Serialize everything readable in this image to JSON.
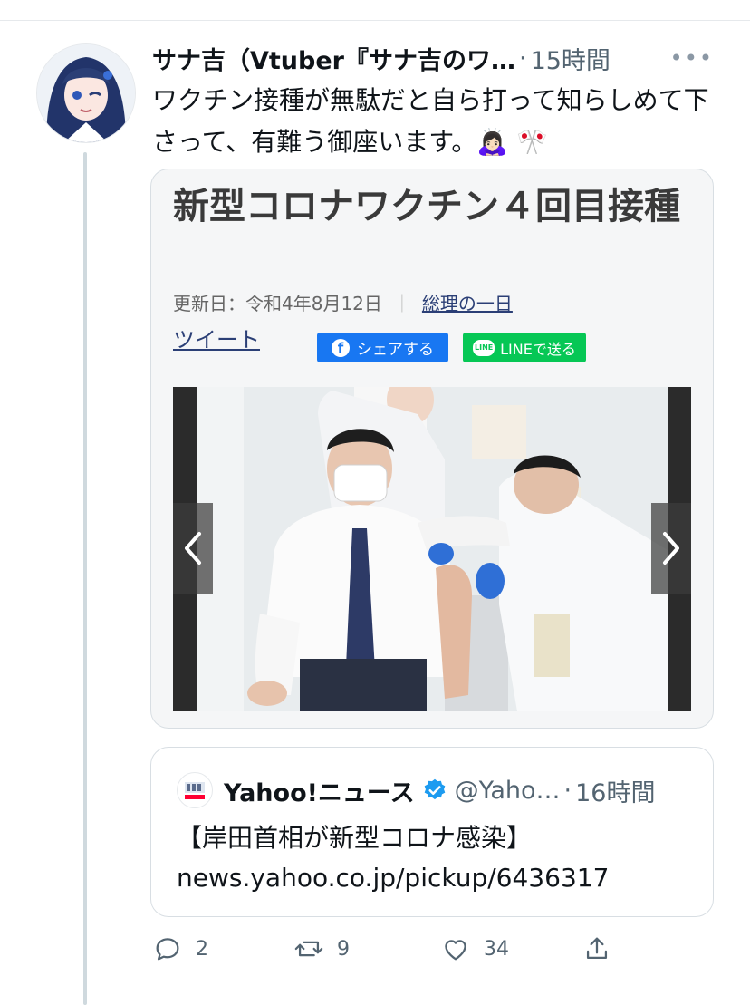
{
  "tweet": {
    "display_name": "サナ吉（Vtuber『サナ吉のワ…",
    "separator": "·",
    "time": "15時間",
    "more": "•••",
    "text": "ワクチン接種が無駄だと自ら打って知らしめて下さって、有難う御座います。🙇🏻‍♀️ 🎌"
  },
  "link_card": {
    "title": "新型コロナワクチン４回目接種",
    "updated": "更新日：令和4年8月12日",
    "meta_separator": "｜",
    "meta_link": "総理の一日",
    "tweet_link": "ツイート",
    "share_facebook": "シェアする",
    "share_line": "LINEで送る",
    "line_icon_text": "LINE",
    "fb_icon_text": "f"
  },
  "quote": {
    "name": "Yahoo!ニュース",
    "handle": "@Yaho…",
    "separator": "·",
    "time": "16時間",
    "text_line1": "【岸田首相が新型コロナ感染】",
    "text_line2": "news.yahoo.co.jp/pickup/6436317"
  },
  "actions": {
    "reply_count": "2",
    "retweet_count": "9",
    "like_count": "34"
  },
  "colors": {
    "facebook": "#1877f2",
    "line": "#06c755",
    "verified": "#1d9bf0",
    "secondary_text": "#536471"
  }
}
